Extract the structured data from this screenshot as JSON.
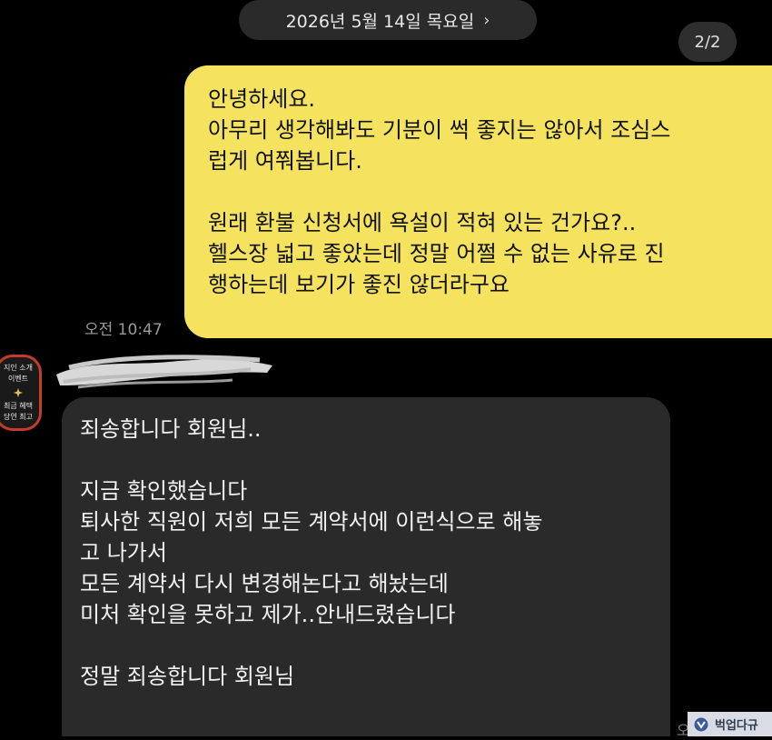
{
  "header": {
    "date": "2026년 5월 14일 목요일",
    "date_chevron": "›",
    "page_counter": "2/2"
  },
  "outgoing_message": {
    "text": "안녕하세요.\n아무리 생각해봐도 기분이 썩 좋지는 않아서 조심스\n럽게 여쭤봅니다.\n\n원래 환불 신청서에 욕설이 적혀 있는 건가요?..\n헬스장 넓고 좋았는데 정말 어쩔 수 없는 사유로 진\n행하는데 보기가 좋진 않더라구요",
    "time": "오전 10:47",
    "bubble_color": "#f5e35f"
  },
  "sender": {
    "avatar_line1": "지인 소개",
    "avatar_line2": "이벤트",
    "avatar_line3": "최금 혜택",
    "avatar_line4": "당연 최고",
    "avatar_border_color": "#c23d2c"
  },
  "incoming_message": {
    "text": "죄송합니다 회원님..\n\n지금 확인했습니다\n퇴사한 직원이 저희 모든 계약서에 이런식으로 해놓\n고 나가서\n모든 계약서 다시 변경해논다고 해놨는데\n미처 확인을 못하고 제가..안내드렸습니다\n\n정말 죄송합니다 회원님",
    "time_partial": "오전",
    "bubble_color": "#2a2a2a"
  },
  "watermark": {
    "text": "벅업다규",
    "icon": "watermark-logo-icon"
  }
}
